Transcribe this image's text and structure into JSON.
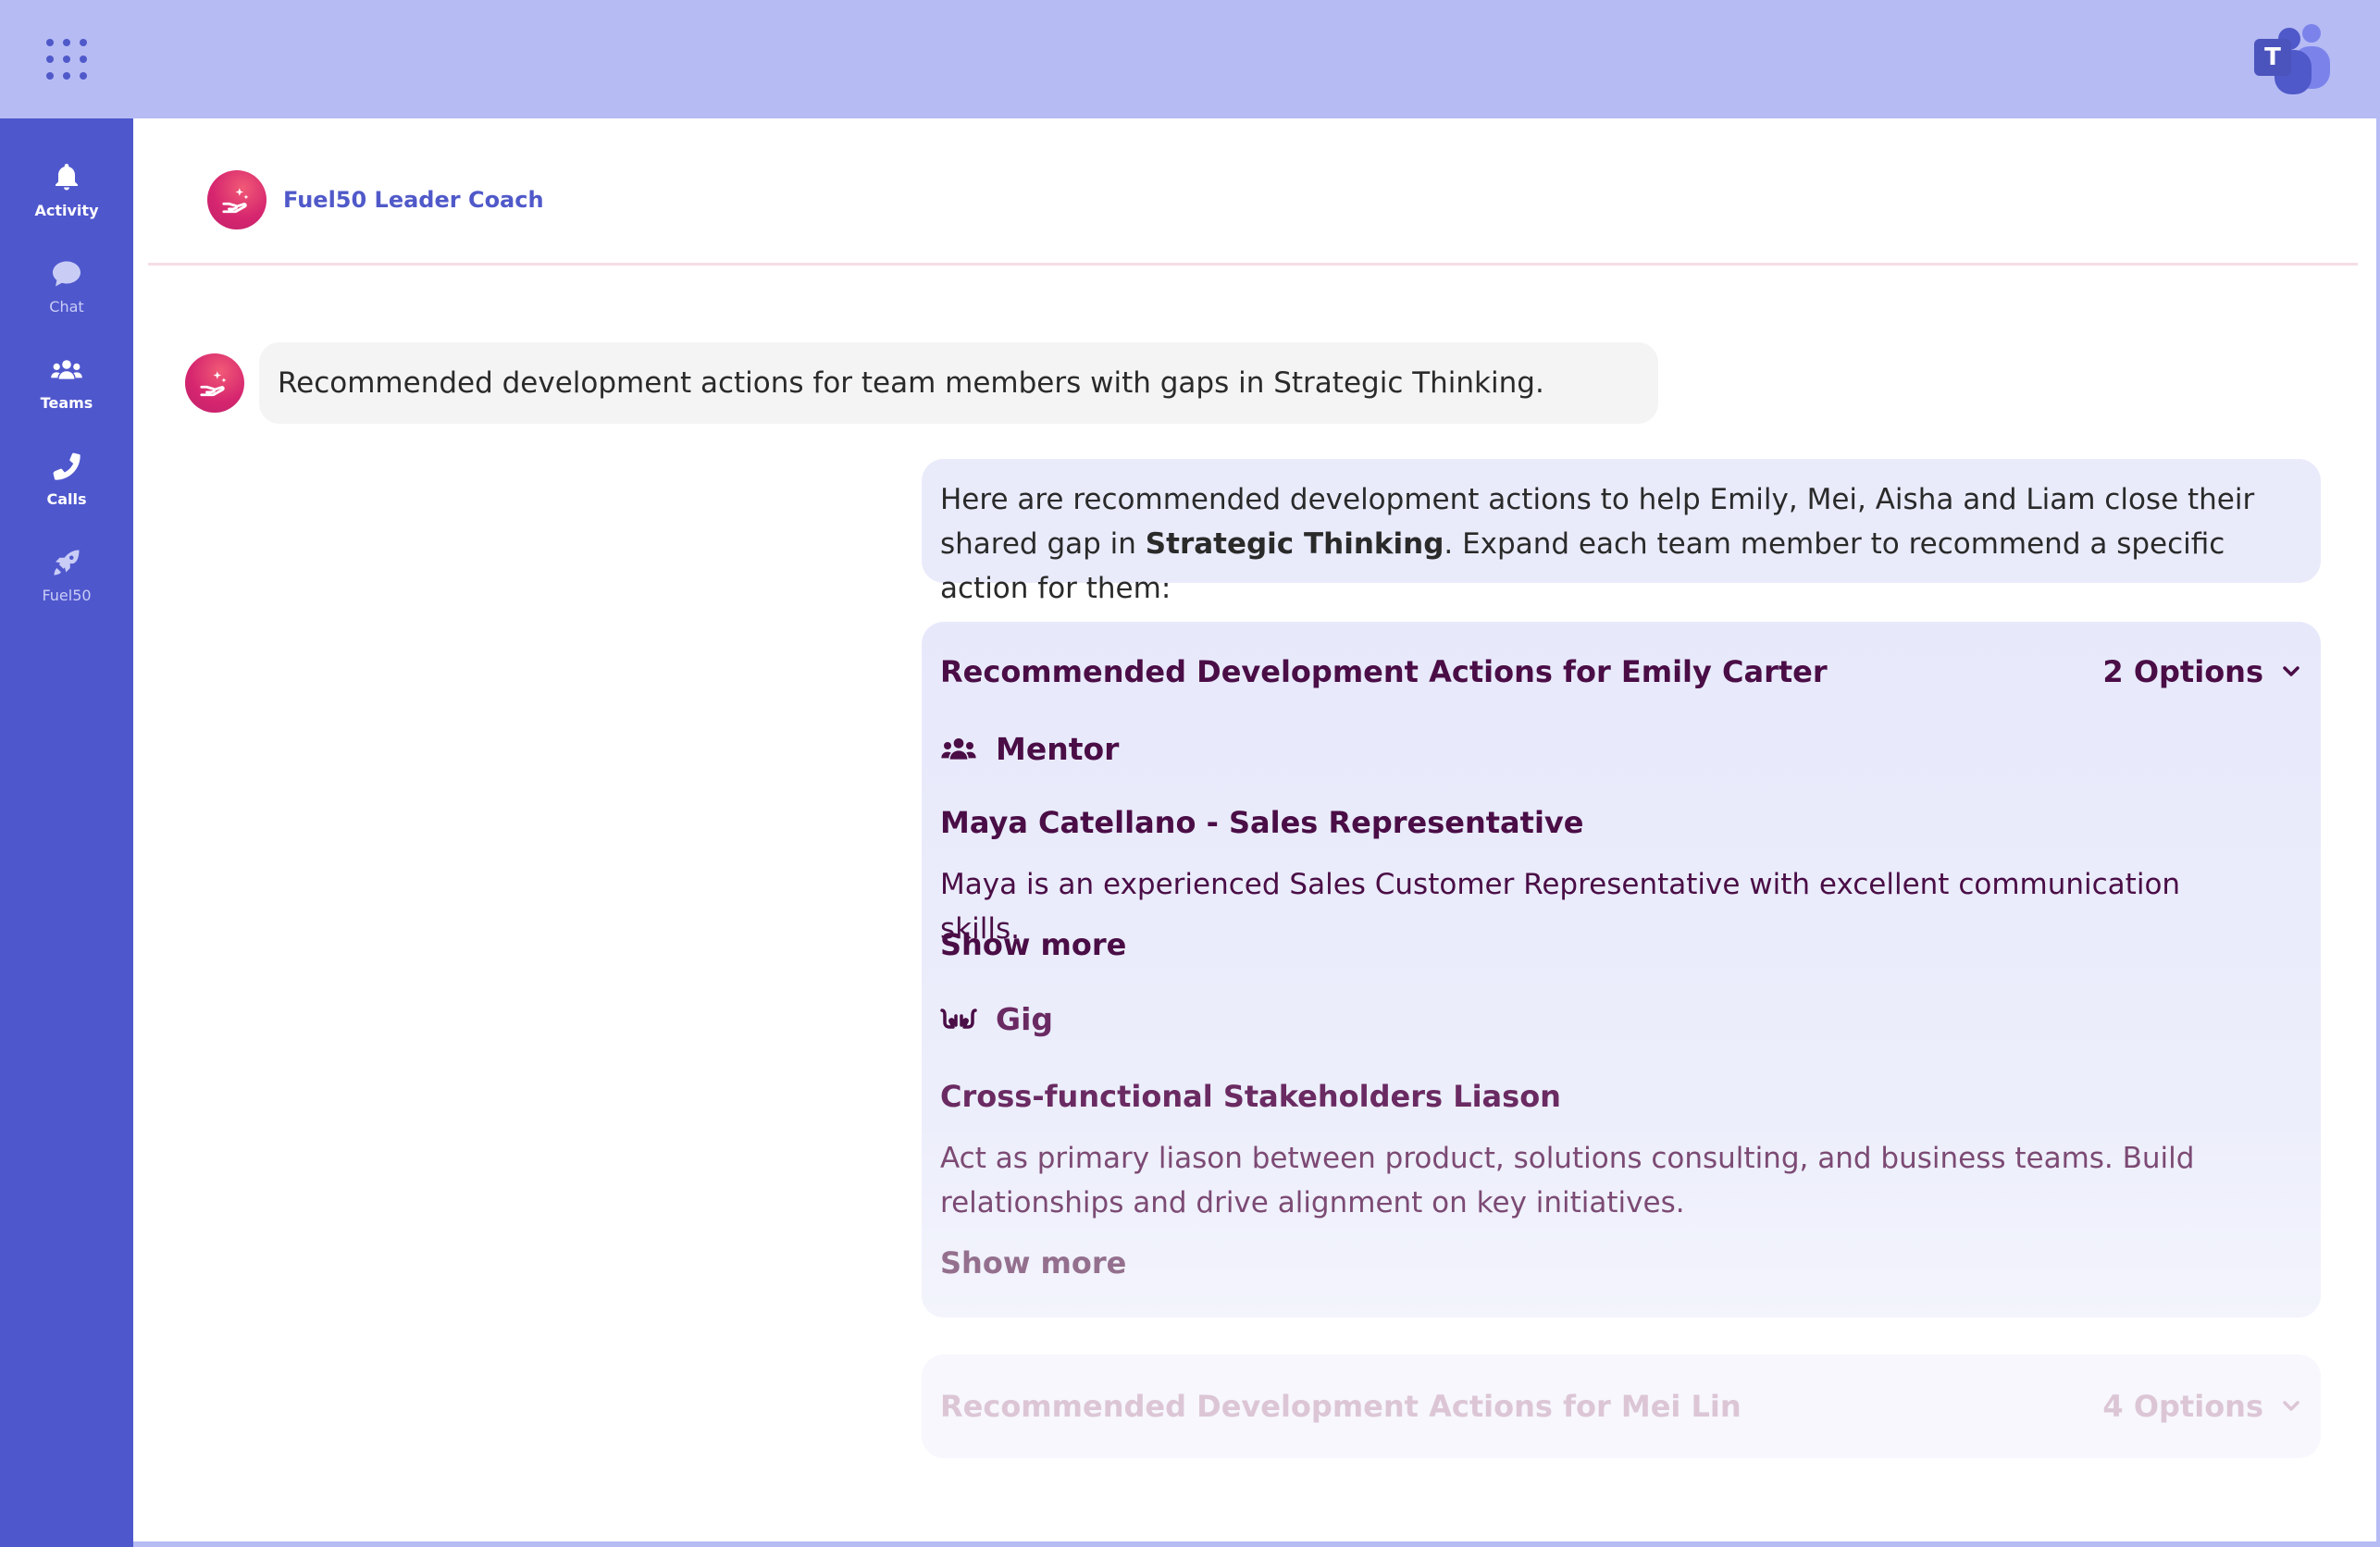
{
  "nav": [
    {
      "label": "Activity",
      "icon": "bell-icon"
    },
    {
      "label": "Chat",
      "icon": "chat-icon"
    },
    {
      "label": "Teams",
      "icon": "people-icon"
    },
    {
      "label": "Calls",
      "icon": "phone-icon"
    },
    {
      "label": "Fuel50",
      "icon": "rocket-icon"
    }
  ],
  "header": {
    "bot_name": "Fuel50 Leader Coach"
  },
  "teams_logo_letter": "T",
  "messages": {
    "user_prompt": "Recommended development actions for team members with gaps in Strategic Thinking.",
    "reply_intro_1": "Here are recommended development actions to help Emily, Mei, Aisha and Liam close their shared gap in ",
    "reply_bold": "Strategic Thinking",
    "reply_intro_2": ". Expand each team member to recommend a specific action for them:"
  },
  "cards": [
    {
      "title": "Recommended Development Actions for Emily Carter",
      "options": "2 Options",
      "sections": [
        {
          "type": "Mentor",
          "icon": "people-icon",
          "item_title": "Maya Catellano - Sales Representative",
          "item_desc": "Maya is an experienced Sales Customer Representative with excellent communication skills.",
          "show_more": "Show more"
        },
        {
          "type": "Gig",
          "icon": "hands-icon",
          "item_title": "Cross-functional Stakeholders Liason",
          "item_desc": "Act as primary liason between product, solutions consulting, and business teams. Build relationships and drive alignment on key initiatives.",
          "show_more": "Show more"
        }
      ]
    },
    {
      "title": "Recommended Development Actions for Mei Lin",
      "options": "4 Options"
    }
  ],
  "colors": {
    "brand": "#5059c9",
    "sidebar": "#4f57cd",
    "topbar": "#b6bbf4",
    "card_text": "#4a0d46",
    "avatar": "#d6266f"
  }
}
